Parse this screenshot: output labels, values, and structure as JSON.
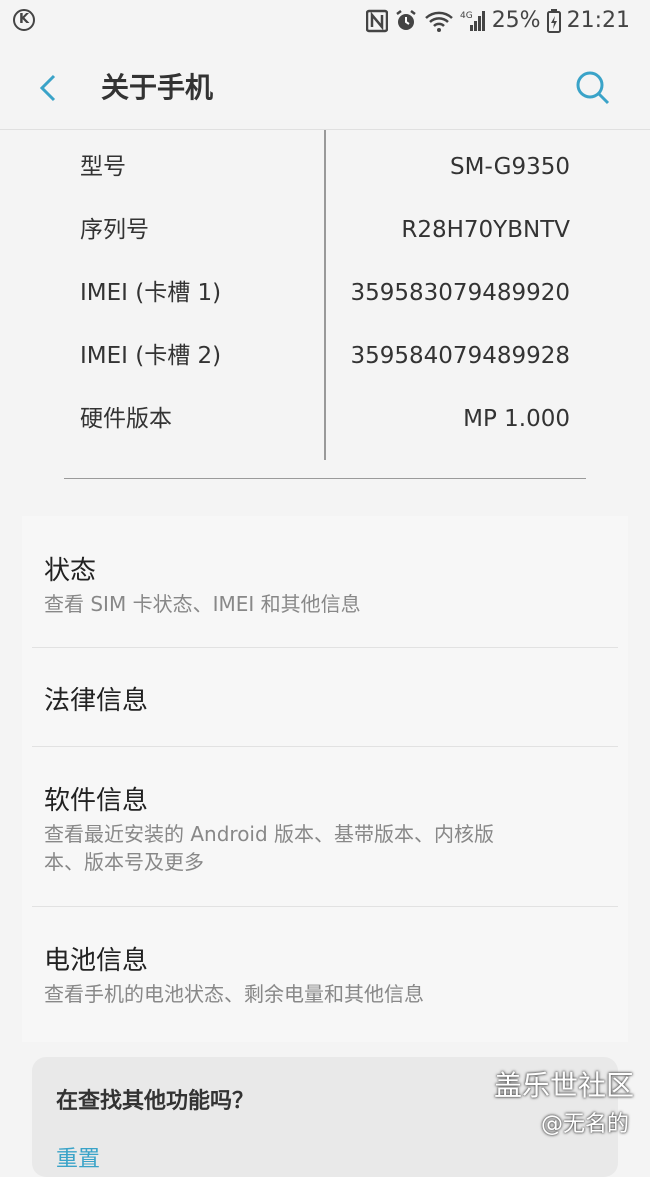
{
  "status_bar": {
    "battery_percent": "25%",
    "time": "21:21",
    "network": "4G",
    "icons": [
      "k-icon",
      "nfc-icon",
      "alarm-icon",
      "wifi-icon",
      "signal-icon",
      "battery-icon"
    ]
  },
  "app_bar": {
    "title": "关于手机",
    "back_icon": "back-arrow-icon",
    "search_icon": "search-icon"
  },
  "device_info": [
    {
      "label": "型号",
      "value": "SM-G9350"
    },
    {
      "label": "序列号",
      "value": "R28H70YBNTV"
    },
    {
      "label": "IMEI (卡槽 1)",
      "value": "359583079489920"
    },
    {
      "label": "IMEI (卡槽 2)",
      "value": "359584079489928"
    },
    {
      "label": "硬件版本",
      "value": "MP 1.000"
    }
  ],
  "menu": [
    {
      "title": "状态",
      "subtitle": "查看 SIM 卡状态、IMEI 和其他信息"
    },
    {
      "title": "法律信息",
      "subtitle": ""
    },
    {
      "title": "软件信息",
      "subtitle": "查看最近安装的 Android 版本、基带版本、内核版本、版本号及更多"
    },
    {
      "title": "电池信息",
      "subtitle": "查看手机的电池状态、剩余电量和其他信息"
    }
  ],
  "find_card": {
    "title": "在查找其他功能吗？",
    "link": "重置"
  },
  "watermark": {
    "line1": "盖乐世社区",
    "line2": "@无名的"
  },
  "colors": {
    "accent": "#3aa3c8",
    "background": "#f4f4f4",
    "card": "#f7f7f7"
  }
}
